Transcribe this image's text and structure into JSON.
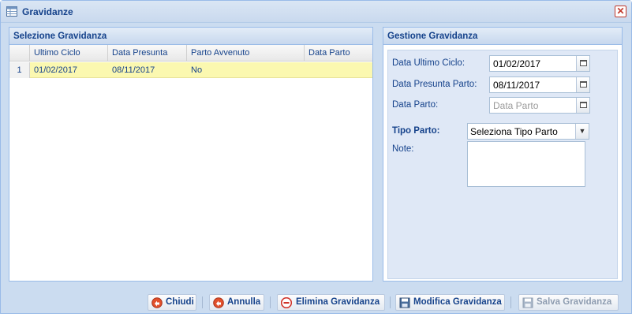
{
  "window": {
    "title": "Gravidanze",
    "close_icon": "close-icon"
  },
  "left_panel": {
    "title": "Selezione Gravidanza",
    "columns": [
      "Ultimo Ciclo",
      "Data Presunta",
      "Parto Avvenuto",
      "Data Parto"
    ],
    "rows": [
      {
        "num": "1",
        "ultimo_ciclo": "01/02/2017",
        "data_presunta": "08/11/2017",
        "parto_avvenuto": "No",
        "data_parto": ""
      }
    ]
  },
  "right_panel": {
    "title": "Gestione Gravidanza",
    "data_ultimo_ciclo": {
      "label": "Data Ultimo Ciclo:",
      "value": "01/02/2017"
    },
    "data_presunta_parto": {
      "label": "Data Presunta Parto:",
      "value": "08/11/2017"
    },
    "data_parto": {
      "label": "Data Parto:",
      "value": "",
      "placeholder": "Data Parto"
    },
    "tipo_parto": {
      "label": "Tipo Parto:",
      "value": "Seleziona Tipo Parto"
    },
    "note": {
      "label": "Note:",
      "value": ""
    }
  },
  "toolbar": {
    "chiudi": "Chiudi",
    "annulla": "Annulla",
    "elimina": "Elimina Gravidanza",
    "modifica": "Modifica Gravidanza",
    "salva": "Salva Gravidanza"
  },
  "colors": {
    "accent": "#15428b",
    "panel_border": "#99bbe8",
    "selected_row": "#fbf8b0",
    "window_bg": "#cbdcf0"
  }
}
